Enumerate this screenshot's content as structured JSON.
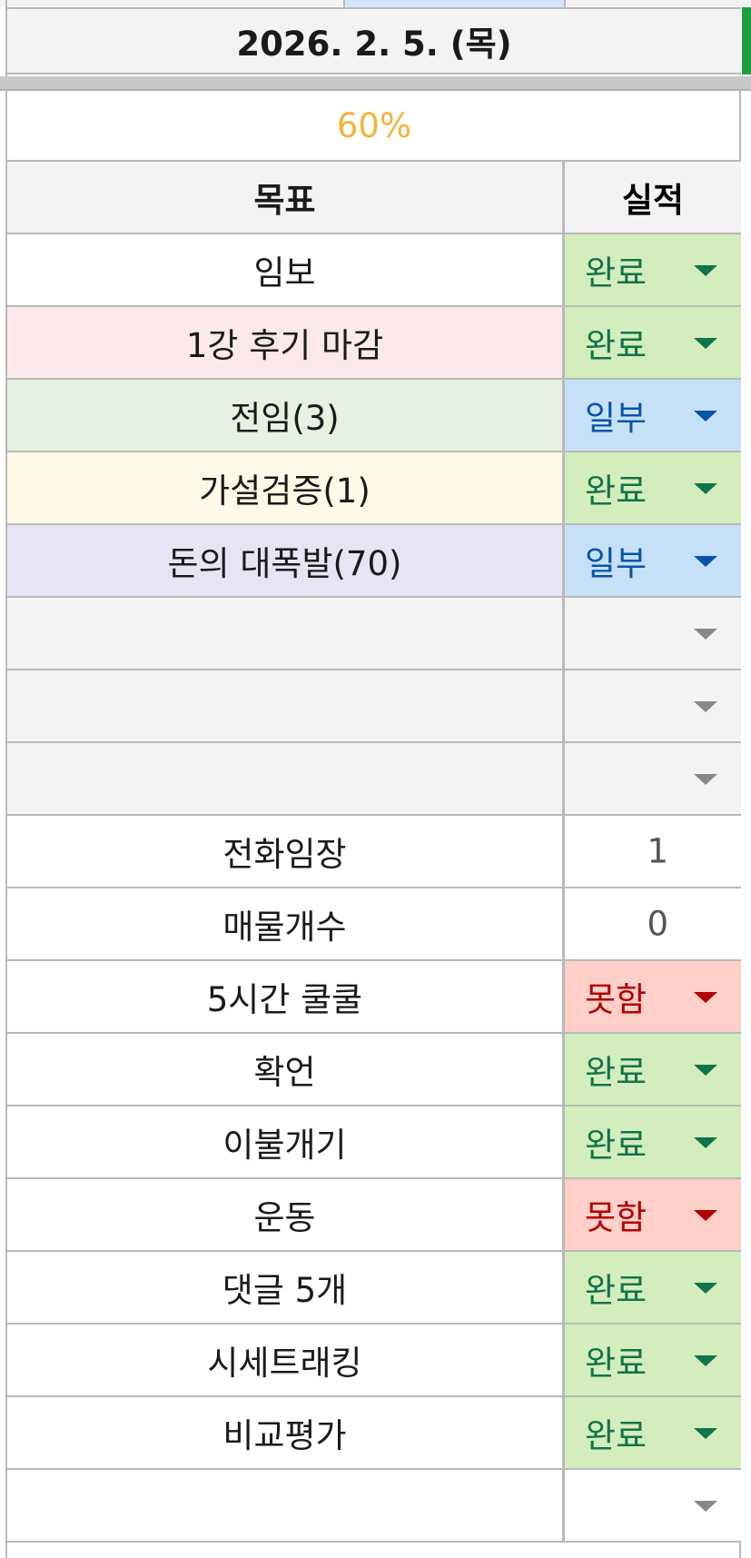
{
  "date_header": "2026. 2. 5. (목)",
  "progress": {
    "label": "60%",
    "value": 60
  },
  "columns": {
    "goal": "목표",
    "result": "실적"
  },
  "rows": [
    {
      "goal": "임보",
      "result": "완료",
      "status": "done",
      "bg": "white",
      "dropdown": true
    },
    {
      "goal": "1강 후기 마감",
      "result": "완료",
      "status": "done",
      "bg": "pink",
      "dropdown": true
    },
    {
      "goal": "전임(3)",
      "result": "일부",
      "status": "part",
      "bg": "green",
      "dropdown": true
    },
    {
      "goal": "가설검증(1)",
      "result": "완료",
      "status": "done",
      "bg": "yellow",
      "dropdown": true
    },
    {
      "goal": "돈의 대폭발(70)",
      "result": "일부",
      "status": "part",
      "bg": "purple",
      "dropdown": true
    },
    {
      "goal": "",
      "result": "",
      "status": "empty",
      "bg": "gray",
      "dropdown": true
    },
    {
      "goal": "",
      "result": "",
      "status": "empty",
      "bg": "gray",
      "dropdown": true
    },
    {
      "goal": "",
      "result": "",
      "status": "empty",
      "bg": "gray",
      "dropdown": true
    },
    {
      "goal": "전화임장",
      "result": "1",
      "status": "number",
      "bg": "white",
      "dropdown": false
    },
    {
      "goal": "매물개수",
      "result": "0",
      "status": "number",
      "bg": "white",
      "dropdown": false
    },
    {
      "goal": "5시간 쿨쿨",
      "result": "못함",
      "status": "fail",
      "bg": "white",
      "dropdown": true
    },
    {
      "goal": "확언",
      "result": "완료",
      "status": "done",
      "bg": "white",
      "dropdown": true
    },
    {
      "goal": "이불개기",
      "result": "완료",
      "status": "done",
      "bg": "white",
      "dropdown": true
    },
    {
      "goal": "운동",
      "result": "못함",
      "status": "fail",
      "bg": "white",
      "dropdown": true
    },
    {
      "goal": "댓글 5개",
      "result": "완료",
      "status": "done",
      "bg": "white",
      "dropdown": true
    },
    {
      "goal": "시세트래킹",
      "result": "완료",
      "status": "done",
      "bg": "white",
      "dropdown": true
    },
    {
      "goal": "비교평가",
      "result": "완료",
      "status": "done",
      "bg": "white",
      "dropdown": true
    },
    {
      "goal": "",
      "result": "",
      "status": "blank",
      "bg": "white",
      "dropdown": true
    }
  ],
  "colors": {
    "progress_text": "#f3b33d",
    "done_bg": "#d4edbc",
    "done_text": "#11734b",
    "part_bg": "#c6e1f7",
    "part_text": "#0a53a8",
    "fail_bg": "#ffcfc9",
    "fail_text": "#b10202",
    "frozen_column_marker": "#1e9e3c"
  },
  "icons": {
    "dropdown": "chevron-down-icon"
  }
}
